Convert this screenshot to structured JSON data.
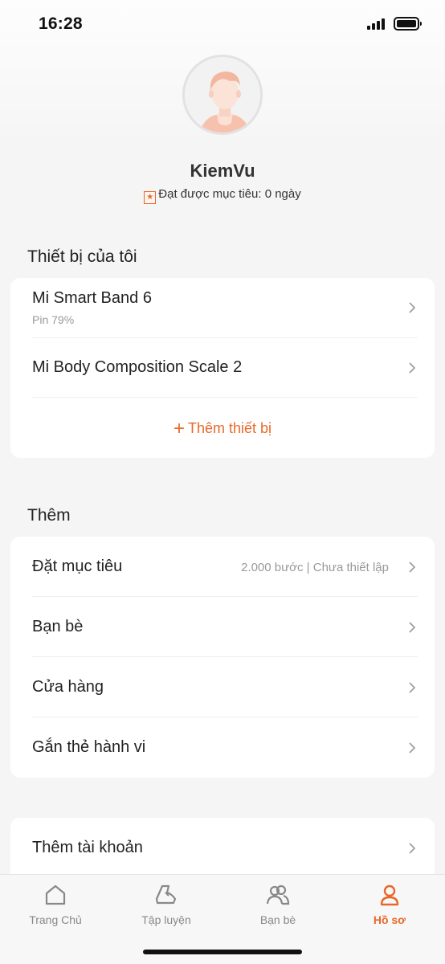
{
  "status_bar": {
    "time": "16:28"
  },
  "profile": {
    "username": "KiemVu",
    "goal_text": "Đạt được mục tiêu: 0 ngày"
  },
  "devices_section": {
    "title": "Thiết bị của tôi",
    "items": [
      {
        "name": "Mi Smart Band 6",
        "sub": "Pin 79%"
      },
      {
        "name": "Mi Body Composition Scale 2"
      }
    ],
    "add_label": "Thêm thiết bị"
  },
  "more_section": {
    "title": "Thêm",
    "items": [
      {
        "label": "Đặt mục tiêu",
        "value": "2.000 bước | Chưa thiết lập"
      },
      {
        "label": "Bạn bè"
      },
      {
        "label": "Cửa hàng"
      },
      {
        "label": "Gắn thẻ hành vi"
      }
    ]
  },
  "account_section": {
    "items": [
      {
        "label": "Thêm tài khoản"
      }
    ]
  },
  "tabbar": {
    "tabs": [
      {
        "label": "Trang Chủ",
        "icon": "home-icon"
      },
      {
        "label": "Tập luyện",
        "icon": "shoe-icon"
      },
      {
        "label": "Bạn bè",
        "icon": "friends-icon"
      },
      {
        "label": "Hồ sơ",
        "icon": "profile-icon",
        "active": true
      }
    ]
  },
  "colors": {
    "accent": "#e8682a",
    "background": "#f5f5f5",
    "card": "#ffffff"
  }
}
